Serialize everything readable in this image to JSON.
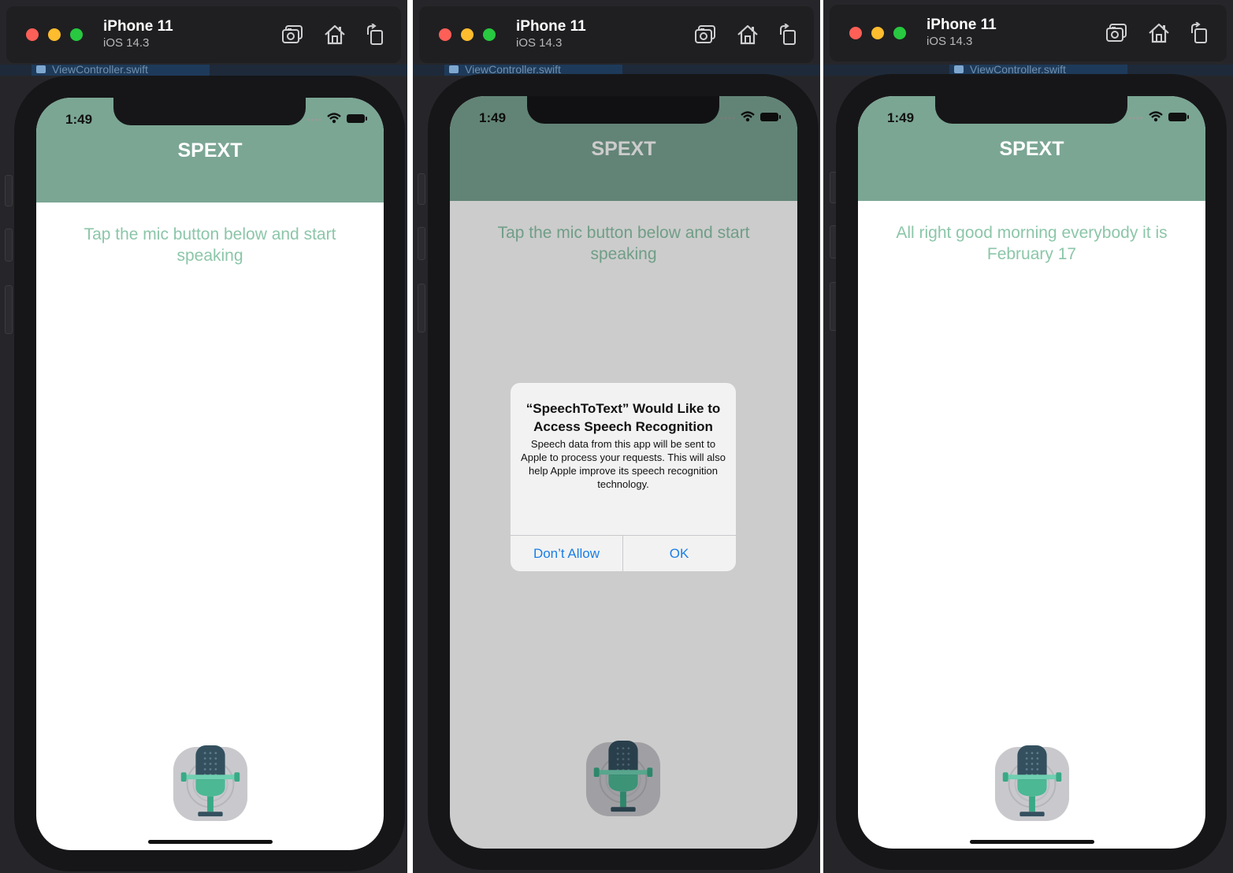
{
  "colors": {
    "nav_green": "#7ba694",
    "prompt_green": "#8cc6a9",
    "alert_blue": "#1a7ee6",
    "dim_overlay": "rgba(0,0,0,0.2)"
  },
  "panels": [
    {
      "device_name": "iPhone 11",
      "os_version": "iOS 14.3",
      "bg_tab": "ViewController.swift",
      "status_time": "1:49",
      "app_title": "SPEXT",
      "prompt_text": "Tap the mic button below and start speaking"
    },
    {
      "device_name": "iPhone 11",
      "os_version": "iOS 14.3",
      "bg_tab": "ViewController.swift",
      "status_time": "1:49",
      "app_title": "SPEXT",
      "prompt_text": "Tap the mic button below and start speaking",
      "alert": {
        "title": "“SpeechToText” Would Like to Access Speech Recognition",
        "message": "Speech data from this app will be sent to Apple to process your requests. This will also help Apple improve its speech recognition technology.",
        "deny_label": "Don’t Allow",
        "ok_label": "OK"
      }
    },
    {
      "device_name": "iPhone 11",
      "os_version": "iOS 14.3",
      "bg_tab": "ViewController.swift",
      "status_time": "1:49",
      "app_title": "SPEXT",
      "prompt_text": "All right good morning everybody it is February 17"
    }
  ],
  "icons": [
    "screenshot-icon",
    "home-icon",
    "rotate-icon",
    "microphone-icon",
    "wifi-icon",
    "battery-icon",
    "cellular-icon"
  ]
}
